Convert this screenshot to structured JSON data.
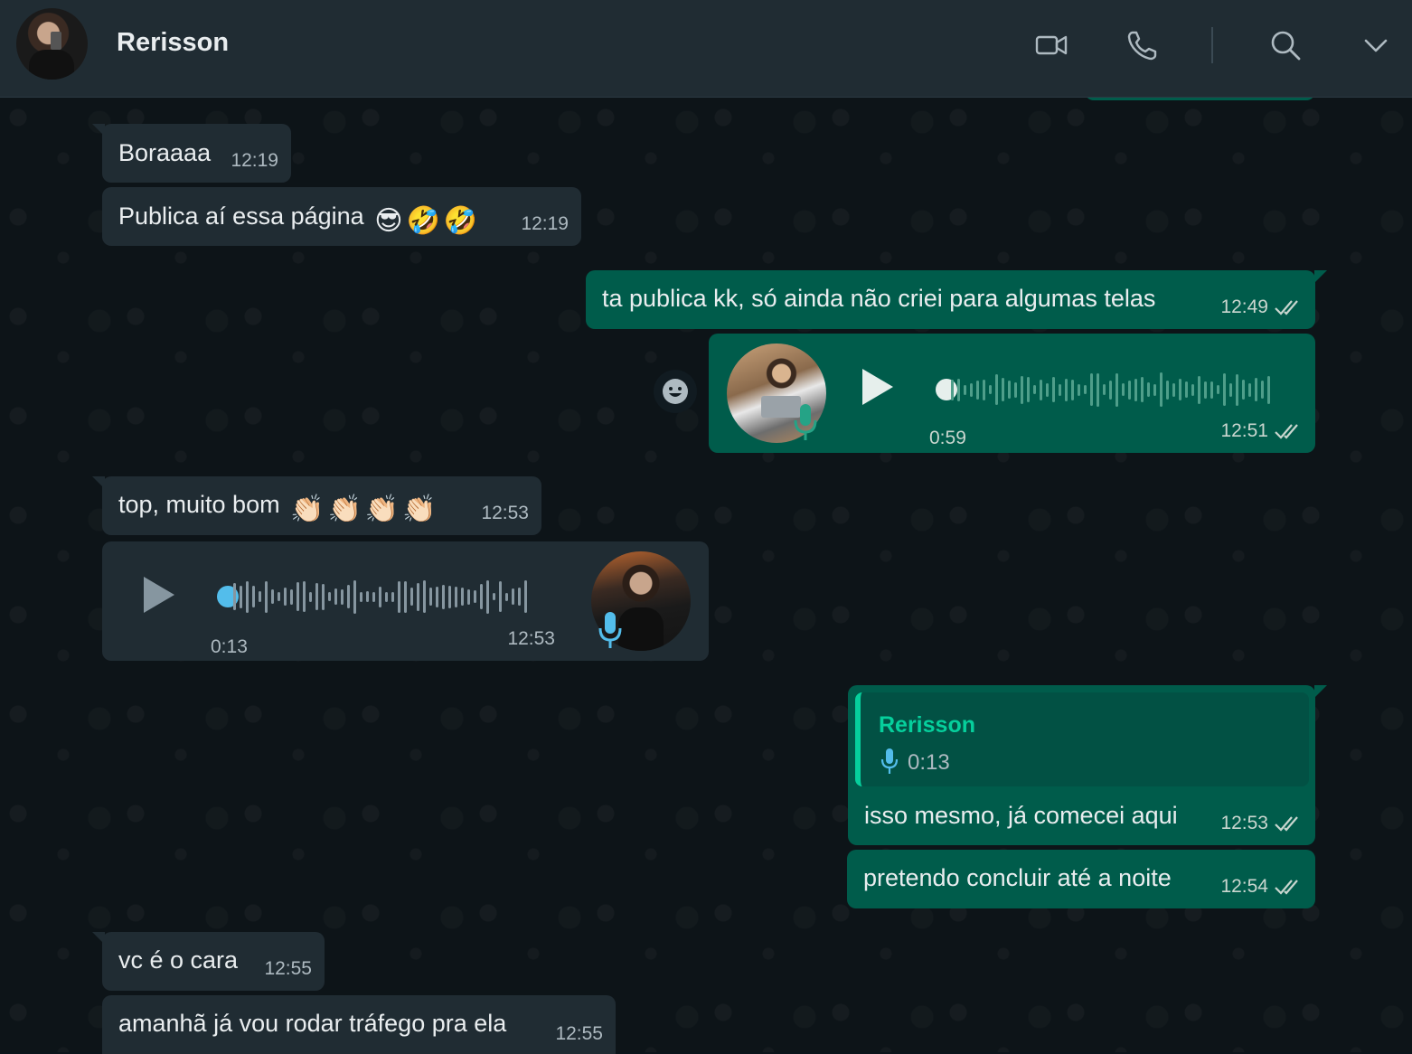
{
  "header": {
    "contact_name": "Rerisson",
    "icons": [
      "video-call-icon",
      "voice-call-icon",
      "search-icon",
      "chevron-down-icon"
    ]
  },
  "colors": {
    "incoming_bubble": "#202c33",
    "outgoing_bubble": "#005c4b",
    "accent": "#06cf9c",
    "read_ticks": "#c9d6cf",
    "audio_unplayed": "#53bdeb"
  },
  "messages": [
    {
      "direction": "in",
      "text": "Boraaaa",
      "time": "12:19"
    },
    {
      "direction": "in",
      "text": "Publica aí essa página",
      "emoji": [
        "😎",
        "🤣",
        "🤣"
      ],
      "time": "12:19"
    },
    {
      "direction": "out",
      "text": "ta publica kk, só ainda não criei para algumas telas",
      "time": "12:49",
      "status": "read"
    },
    {
      "direction": "out",
      "type": "audio",
      "duration": "0:59",
      "time": "12:51",
      "status": "read"
    },
    {
      "direction": "in",
      "text": "top, muito bom",
      "emoji": [
        "👏🏻",
        "👏🏻",
        "👏🏻",
        "👏🏻"
      ],
      "time": "12:53"
    },
    {
      "direction": "in",
      "type": "audio",
      "duration": "0:13",
      "time": "12:53"
    },
    {
      "direction": "out",
      "quote_name": "Rerisson",
      "quote_duration": "0:13",
      "text": "isso mesmo, já comecei aqui",
      "time": "12:53",
      "status": "read"
    },
    {
      "direction": "out",
      "text": "pretendo concluir até a noite",
      "time": "12:54",
      "status": "read"
    },
    {
      "direction": "in",
      "text": "vc é o cara",
      "time": "12:55"
    },
    {
      "direction": "in",
      "text": "amanhã já vou rodar tráfego pra ela",
      "time": "12:55"
    }
  ]
}
